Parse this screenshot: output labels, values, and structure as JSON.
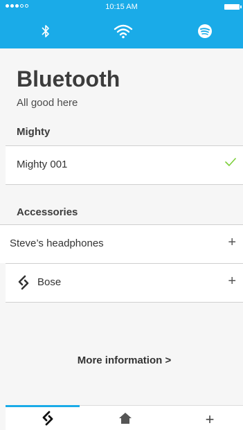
{
  "status": {
    "time": "10:15 AM",
    "signal_dots_filled": 3,
    "signal_dots_total": 5
  },
  "top_tabs": [
    {
      "name": "bluetooth",
      "icon": "bluetooth-icon"
    },
    {
      "name": "wifi",
      "icon": "wifi-icon"
    },
    {
      "name": "spotify",
      "icon": "spotify-icon"
    }
  ],
  "page": {
    "title": "Bluetooth",
    "subtitle": "All good here"
  },
  "sections": {
    "mighty": {
      "label": "Mighty",
      "items": [
        {
          "label": "Mighty 001",
          "status_icon": "checkmark-icon"
        }
      ]
    },
    "accessories": {
      "label": "Accessories",
      "items": [
        {
          "label": "Steve’s headphones",
          "action": "+"
        },
        {
          "label": "Bose",
          "action": "+",
          "icon": "link-icon"
        }
      ]
    }
  },
  "more_info": "More information >",
  "bottom_tabs": [
    {
      "name": "link",
      "icon": "link-icon",
      "active": true
    },
    {
      "name": "home",
      "icon": "home-icon",
      "active": false
    },
    {
      "name": "add",
      "label": "+",
      "active": false
    }
  ],
  "colors": {
    "accent": "#1aabe8",
    "check": "#7ccf3a",
    "background": "#f6f6f6"
  }
}
